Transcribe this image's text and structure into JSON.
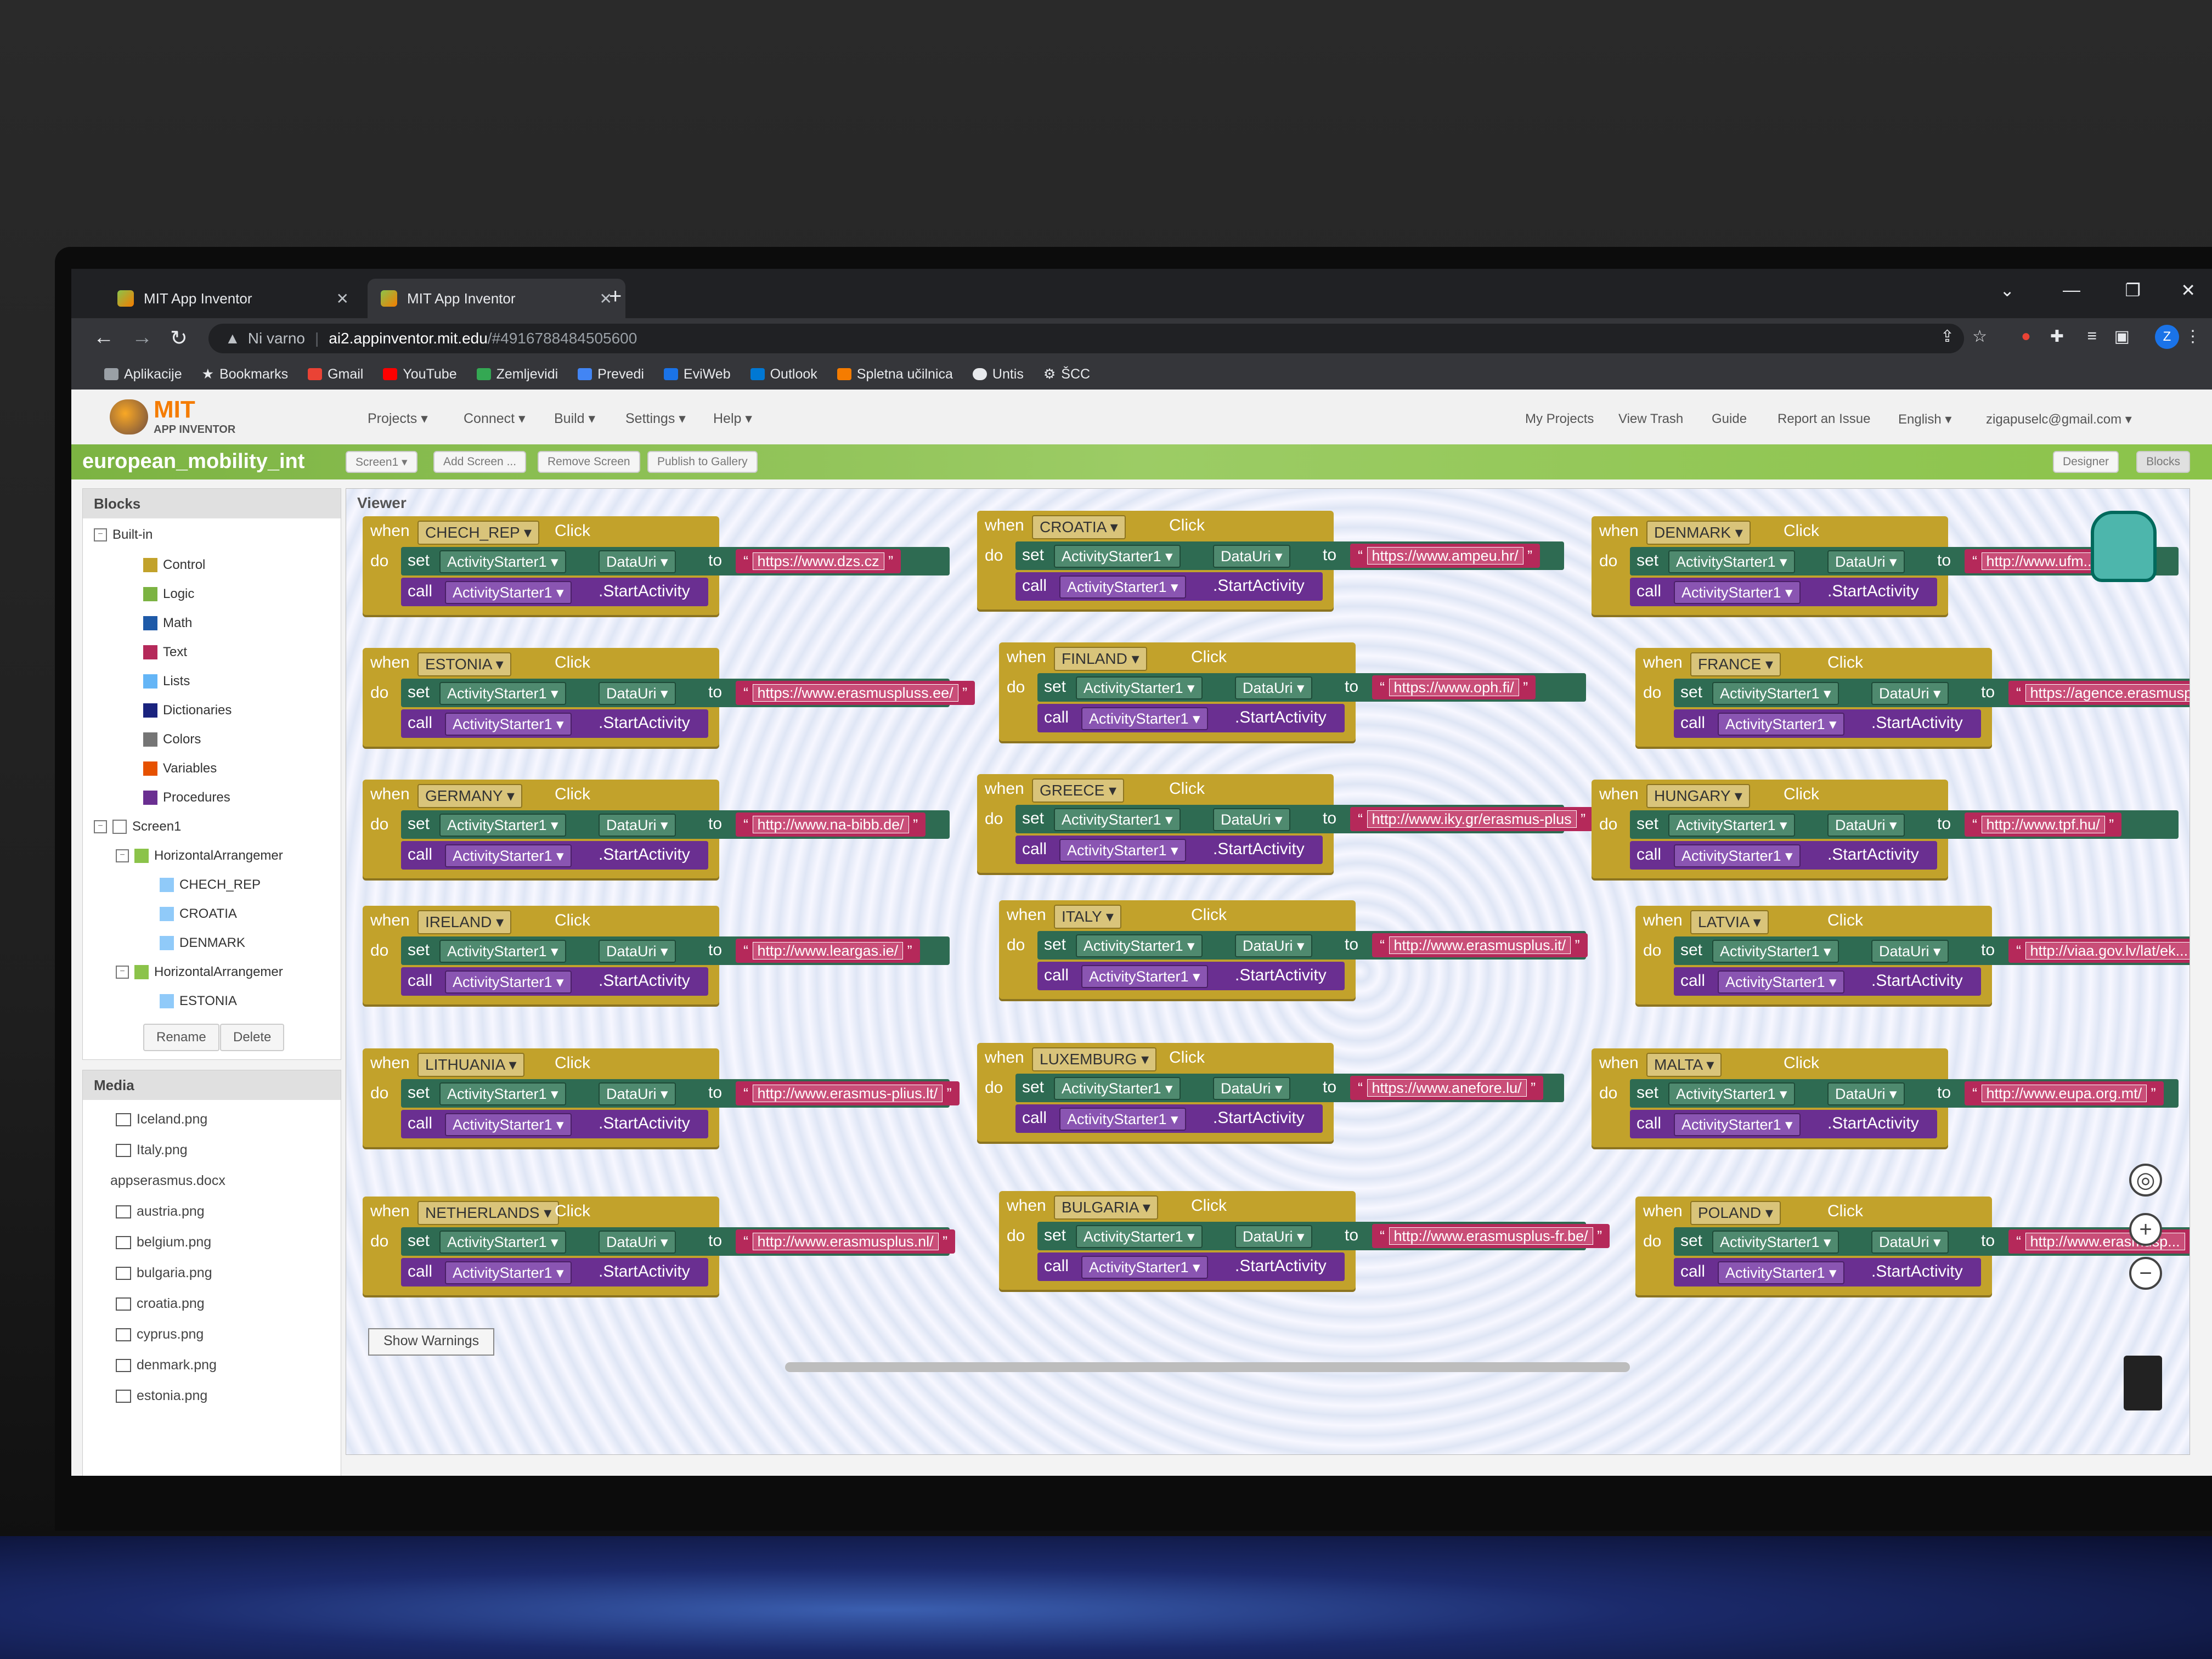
{
  "browser": {
    "tabs": [
      {
        "title": "MIT App Inventor"
      },
      {
        "title": "MIT App Inventor"
      }
    ],
    "security_label": "Ni varno",
    "url_host": "ai2.appinventor.mit.edu",
    "url_path": "/#4916788484505600",
    "profile_initial": "Z",
    "bookmarks": [
      {
        "label": "Aplikacije",
        "color": "#9aa0a6"
      },
      {
        "label": "Bookmarks",
        "color": "#e8eaed"
      },
      {
        "label": "Gmail",
        "color": "#ea4335"
      },
      {
        "label": "YouTube",
        "color": "#ff0000"
      },
      {
        "label": "Zemljevidi",
        "color": "#34a853"
      },
      {
        "label": "Prevedi",
        "color": "#4285f4"
      },
      {
        "label": "EviWeb",
        "color": "#1a73e8"
      },
      {
        "label": "Outlook",
        "color": "#0078d4"
      },
      {
        "label": "Spletna učilnica",
        "color": "#f57c00"
      },
      {
        "label": "Untis",
        "color": "#e8eaed"
      },
      {
        "label": "ŠCC",
        "color": "#e8eaed"
      }
    ]
  },
  "app": {
    "logo_text": "MIT",
    "logo_sub": "APP INVENTOR",
    "menus": [
      "Projects ▾",
      "Connect ▾",
      "Build ▾",
      "Settings ▾",
      "Help ▾"
    ],
    "right_menus": [
      "My Projects",
      "View Trash",
      "Guide",
      "Report an Issue",
      "English ▾",
      "zigapuselc@gmail.com ▾"
    ],
    "project_name": "european_mobility_int",
    "project_buttons": [
      "Screen1 ▾",
      "Add Screen ...",
      "Remove Screen",
      "Publish to Gallery"
    ],
    "view_buttons": [
      "Designer",
      "Blocks"
    ]
  },
  "blocks_panel": {
    "title": "Blocks",
    "builtin_label": "Built-in",
    "builtins": [
      {
        "label": "Control",
        "color": "#c2a22b"
      },
      {
        "label": "Logic",
        "color": "#7cb342"
      },
      {
        "label": "Math",
        "color": "#1e5aa8"
      },
      {
        "label": "Text",
        "color": "#b5295a"
      },
      {
        "label": "Lists",
        "color": "#64b5f6"
      },
      {
        "label": "Dictionaries",
        "color": "#1a237e"
      },
      {
        "label": "Colors",
        "color": "#757575"
      },
      {
        "label": "Variables",
        "color": "#e65100"
      },
      {
        "label": "Procedures",
        "color": "#6a2f91"
      }
    ],
    "screen_label": "Screen1",
    "components": [
      "HorizontalArrangemer",
      "CHECH_REP",
      "CROATIA",
      "DENMARK",
      "HorizontalArrangemer",
      "ESTONIA"
    ],
    "rename_label": "Rename",
    "delete_label": "Delete"
  },
  "media_panel": {
    "title": "Media",
    "items": [
      "Iceland.png",
      "Italy.png",
      "appserasmus.docx",
      "austria.png",
      "belgium.png",
      "bulgaria.png",
      "croatia.png",
      "cyprus.png",
      "denmark.png",
      "estonia.png"
    ]
  },
  "viewer": {
    "title": "Viewer",
    "show_warnings_label": "Show Warnings",
    "kw_when": "when",
    "kw_do": "do",
    "kw_click": "Click",
    "kw_set": "set",
    "kw_call": "call",
    "kw_to": "to",
    "component": "ActivityStarter1 ▾",
    "prop_datauri": "DataUri ▾",
    "method_start": ".StartActivity",
    "blocks": [
      {
        "button": "CHECH_REP ▾",
        "url": "https://www.dzs.cz"
      },
      {
        "button": "CROATIA ▾",
        "url": "https://www.ampeu.hr/"
      },
      {
        "button": "DENMARK ▾",
        "url": "http://www.ufm..."
      },
      {
        "button": "ESTONIA ▾",
        "url": "https://www.erasmuspluss.ee/"
      },
      {
        "button": "FINLAND ▾",
        "url": "https://www.oph.fi/"
      },
      {
        "button": "FRANCE ▾",
        "url": "https://agence.erasmuspl..."
      },
      {
        "button": "GERMANY ▾",
        "url": "http://www.na-bibb.de/"
      },
      {
        "button": "GREECE ▾",
        "url": "http://www.iky.gr/erasmus-plus"
      },
      {
        "button": "HUNGARY ▾",
        "url": "http://www.tpf.hu/"
      },
      {
        "button": "IRELAND ▾",
        "url": "http://www.leargas.ie/"
      },
      {
        "button": "ITALY ▾",
        "url": "http://www.erasmusplus.it/"
      },
      {
        "button": "LATVIA ▾",
        "url": "http://viaa.gov.lv/lat/ek..."
      },
      {
        "button": "LITHUANIA ▾",
        "url": "http://www.erasmus-plius.lt/"
      },
      {
        "button": "LUXEMBURG ▾",
        "url": "https://www.anefore.lu/"
      },
      {
        "button": "MALTA ▾",
        "url": "http://www.eupa.org.mt/"
      },
      {
        "button": "NETHERLANDS ▾",
        "url": "http://www.erasmusplus.nl/"
      },
      {
        "button": "BULGARIA ▾",
        "url": "http://www.erasmusplus-fr.be/"
      },
      {
        "button": "POLAND ▾",
        "url": "http://www.erasmusp..."
      }
    ]
  }
}
